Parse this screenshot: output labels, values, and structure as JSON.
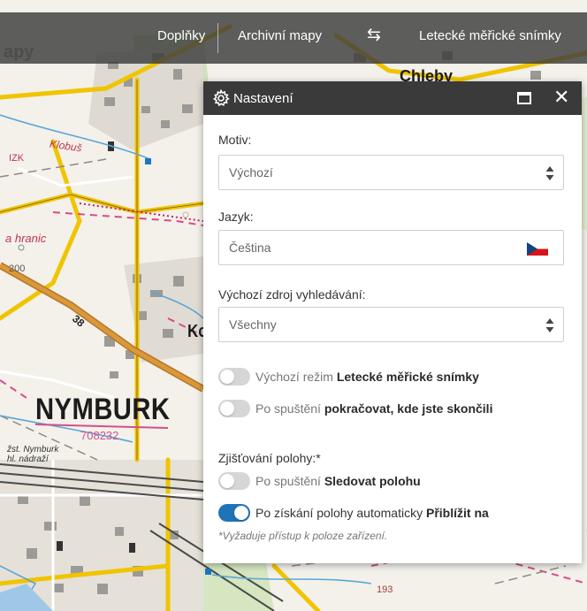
{
  "map": {
    "labels": {
      "town": "NYMBURK",
      "town_code": "708232",
      "klobus": "Klobuš",
      "izk": "IZK",
      "hranice": "a hranic",
      "elevation": "200",
      "road_number": "38",
      "partial_town": "Ko",
      "station": "žst. Nymburk\nhl. nádraží",
      "chleby": "Chleby",
      "mapy_partial": "apy",
      "elev_193": "193"
    }
  },
  "toolbar": {
    "items": [
      {
        "label": "Doplňky"
      },
      {
        "label": "Archivní mapy"
      },
      {
        "label": "⇆"
      },
      {
        "label": "Letecké měřické snímky"
      }
    ]
  },
  "settings": {
    "title": "Nastavení",
    "motiv": {
      "label": "Motiv:",
      "value": "Výchozí"
    },
    "jazyk": {
      "label": "Jazyk:",
      "value": "Čeština"
    },
    "zdroj": {
      "label": "Výchozí zdroj vyhledávání:",
      "value": "Všechny"
    },
    "toggles": [
      {
        "muted": "Výchozí režim ",
        "strong": "Letecké měřické snímky",
        "on": false
      },
      {
        "muted": "Po spuštění ",
        "strong": "pokračovat, kde jste skončili",
        "on": false
      }
    ],
    "location": {
      "label": "Zjišťování polohy:*",
      "toggles": [
        {
          "muted": "Po spuštění ",
          "strong": "Sledovat polohu",
          "on": false
        },
        {
          "muted": "Po získání polohy automaticky ",
          "strong": "Přiblížit na",
          "on": true
        }
      ],
      "footnote": "*Vyžaduje přístup k poloze zařízení."
    }
  },
  "colors": {
    "toggle_on": "#1f73b7",
    "header_bg": "#3a3a3a"
  }
}
